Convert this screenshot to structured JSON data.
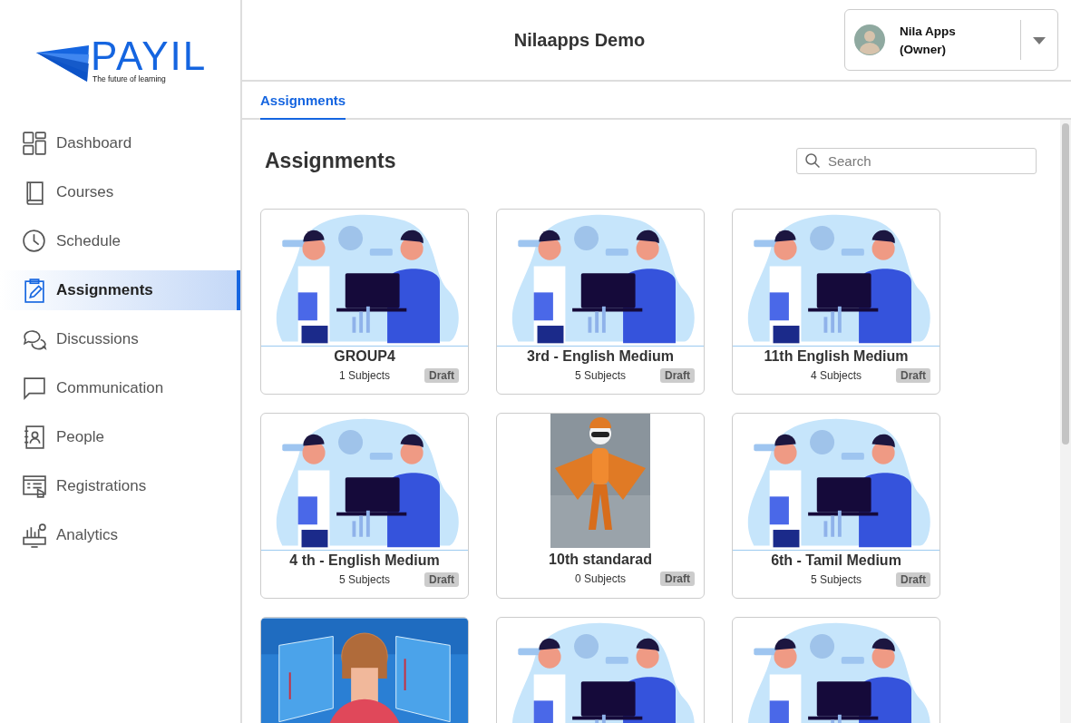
{
  "logo": {
    "wordmark": "PAYIL",
    "tagline": "The future of learning"
  },
  "sidebar": {
    "items": [
      {
        "label": "Dashboard",
        "selected": false
      },
      {
        "label": "Courses",
        "selected": false
      },
      {
        "label": "Schedule",
        "selected": false
      },
      {
        "label": "Assignments",
        "selected": true
      },
      {
        "label": "Discussions",
        "selected": false
      },
      {
        "label": "Communication",
        "selected": false
      },
      {
        "label": "People",
        "selected": false
      },
      {
        "label": "Registrations",
        "selected": false
      },
      {
        "label": "Analytics",
        "selected": false
      }
    ]
  },
  "header": {
    "title": "Nilaapps Demo",
    "user": {
      "name": "Nila Apps",
      "role": "(Owner)"
    }
  },
  "tabs": [
    {
      "label": "Assignments",
      "selected": true
    }
  ],
  "page": {
    "title": "Assignments",
    "search": {
      "placeholder": "Search"
    }
  },
  "cards": [
    {
      "kind": "picture",
      "title": "GROUP4",
      "subjects": "1 Subjects",
      "status": "Draft"
    },
    {
      "kind": "picture",
      "title": "3rd - English Medium",
      "subjects": "5 Subjects",
      "status": "Draft"
    },
    {
      "kind": "picture",
      "title": "11th English Medium",
      "subjects": "4 Subjects",
      "status": "Draft"
    },
    {
      "kind": "picture",
      "title": "4 th - English Medium",
      "subjects": "5 Subjects",
      "status": "Draft"
    },
    {
      "kind": "picture",
      "title": "10th standarad",
      "subjects": "0 Subjects",
      "status": "Draft"
    },
    {
      "kind": "picture",
      "title": "6th - Tamil Medium",
      "subjects": "5 Subjects",
      "status": "Draft"
    },
    {
      "kind": "picture"
    },
    {
      "kind": "picture"
    },
    {
      "kind": "picture"
    }
  ]
}
